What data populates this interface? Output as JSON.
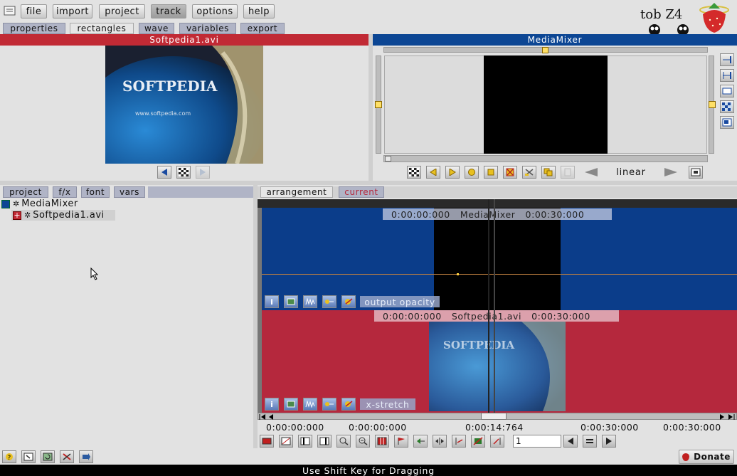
{
  "menu": {
    "items": [
      "file",
      "import",
      "project",
      "track",
      "options",
      "help"
    ],
    "active": "track"
  },
  "top_tabs": [
    "properties",
    "rectangles",
    "wave",
    "variables",
    "export"
  ],
  "active_top_tab": "rectangles",
  "logo": {
    "text": "tob Z4"
  },
  "source_preview": {
    "title": "Softpedia1.avi",
    "image_text": "SOFTPEDIA",
    "image_subtext": "www.softpedia.com"
  },
  "mixer": {
    "title": "MediaMixer",
    "interpolation": "linear"
  },
  "left_tabs": [
    "project",
    "f/x",
    "font",
    "vars"
  ],
  "tree": {
    "root": "MediaMixer",
    "child": "Softpedia1.avi"
  },
  "arrange_tabs": [
    "arrangement",
    "current"
  ],
  "tracks": [
    {
      "start": "0:00:00:000",
      "name": "MediaMixer",
      "end": "0:00:30:000",
      "param": "output opacity",
      "color": "#0b3d8a"
    },
    {
      "start": "0:00:00:000",
      "name": "Softpedia1.avi",
      "end": "0:00:30:000",
      "param": "x-stretch",
      "color": "#b5283d"
    }
  ],
  "timeline": {
    "t1": "0:00:00:000",
    "t2": "0:00:00:000",
    "t3": "0:00:14:764",
    "t4": "0:00:30:000",
    "t5": "0:00:30:000",
    "frame_value": "1"
  },
  "donate_label": "Donate",
  "status": "Use Shift Key for Dragging",
  "colors": {
    "red_bar": "#c12a35",
    "blue_bar": "#0c4694",
    "track_blue": "#0b3d8a",
    "track_red": "#b5283d"
  }
}
